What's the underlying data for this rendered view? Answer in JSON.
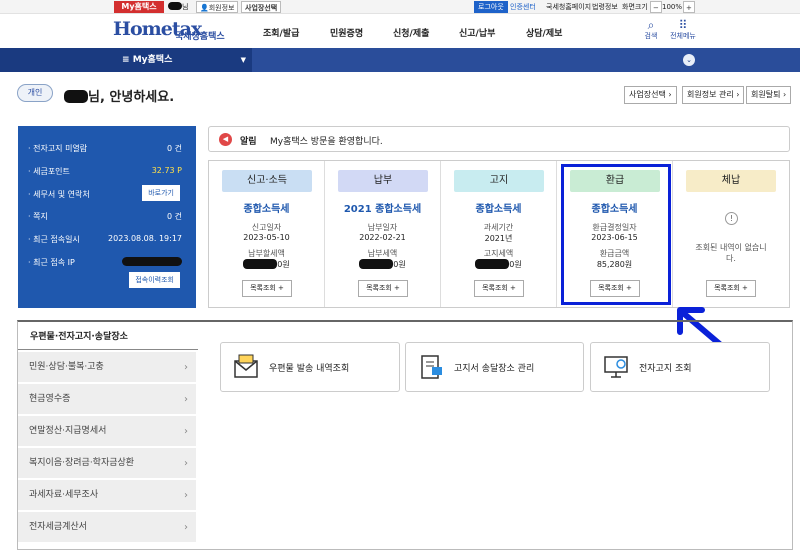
{
  "topbar": {
    "my_hometax": "My홈택스",
    "name_suffix": "님",
    "member_info": "회원정보",
    "biz_select": "사업장선택",
    "logout": "로그아웃",
    "auth_center": "인증센터",
    "nts_page": "국세청홈페이지",
    "legal_page": "법령정보",
    "screen_size": "화면크기",
    "zoom": "100%",
    "zoom_minus": "−",
    "zoom_plus": "+"
  },
  "header": {
    "logo": "Hometax",
    "logo_sub": "국세청홈택스",
    "nav": [
      "조회/발급",
      "민원증명",
      "신청/제출",
      "신고/납부",
      "상담/제보"
    ],
    "search": "검색",
    "all_menu": "전체메뉴"
  },
  "navbar": {
    "tab": "My홈택스"
  },
  "profile": {
    "badge": "개인",
    "greeting": "님, 안녕하세요.",
    "buttons": [
      "사업장선택",
      "회원정보 관리",
      "회원탈퇴"
    ]
  },
  "summary": {
    "rows": [
      {
        "label": "전자고지 미열람",
        "value": "0 건"
      },
      {
        "label": "세금포인트",
        "value": "32.73 P"
      },
      {
        "label": "세무서 및 연락처",
        "value": ""
      },
      {
        "label": "쪽지",
        "value": "0 건"
      },
      {
        "label": "최근 접속일시",
        "value": "2023.08.08. 19:17"
      },
      {
        "label": "최근 접속 IP",
        "value": ""
      }
    ],
    "shortcut_btn": "바로가기",
    "history_btn": "접속이력조회"
  },
  "notice": {
    "tag": "알림",
    "message": "My홈택스 방문을 환영합니다."
  },
  "cards": [
    {
      "header": "신고·소득",
      "title": "종합소득세",
      "l1": "신고일자",
      "v1": "2023-05-10",
      "l2": "납부할세액",
      "v2": "0원",
      "btn": "목록조회 +",
      "color": "#c9def3"
    },
    {
      "header": "납부",
      "title": "2021 종합소득세",
      "l1": "납부일자",
      "v1": "2022-02-21",
      "l2": "납부세액",
      "v2": "0원",
      "btn": "목록조회 +",
      "color": "#d2d9f5"
    },
    {
      "header": "고지",
      "title": "종합소득세",
      "l1": "과세기간",
      "v1": "2021년",
      "l2": "고지세액",
      "v2": "0원",
      "btn": "목록조회 +",
      "color": "#c8ecf0"
    },
    {
      "header": "환급",
      "title": "종합소득세",
      "l1": "환급결정일자",
      "v1": "2023-06-15",
      "l2": "환급금액",
      "v2": "85,280원",
      "btn": "목록조회 +",
      "color": "#c9ecd4"
    },
    {
      "header": "체납",
      "title": "",
      "l1": "",
      "v1": "",
      "l2": "",
      "v2": "",
      "btn": "목록조회 +",
      "color": "#f7ecc8",
      "empty": "조회된 내역이 없습니다."
    }
  ],
  "mail_section": {
    "title": "우편물·전자고지·송달장소",
    "menu": [
      "민원·상담·불복·고충",
      "현금영수증",
      "연말정산·지급명세서",
      "복지이음·장려금·학자금상환",
      "과세자료·세무조사",
      "전자세금계산서"
    ],
    "services": [
      "우편물 발송 내역조회",
      "고지서 송달장소 관리",
      "전자고지 조회"
    ]
  },
  "colors": {
    "primary": "#1f58ae",
    "navbar": "#2a4d9a",
    "highlight": "#0a21d8",
    "alert": "#d32f2f"
  }
}
